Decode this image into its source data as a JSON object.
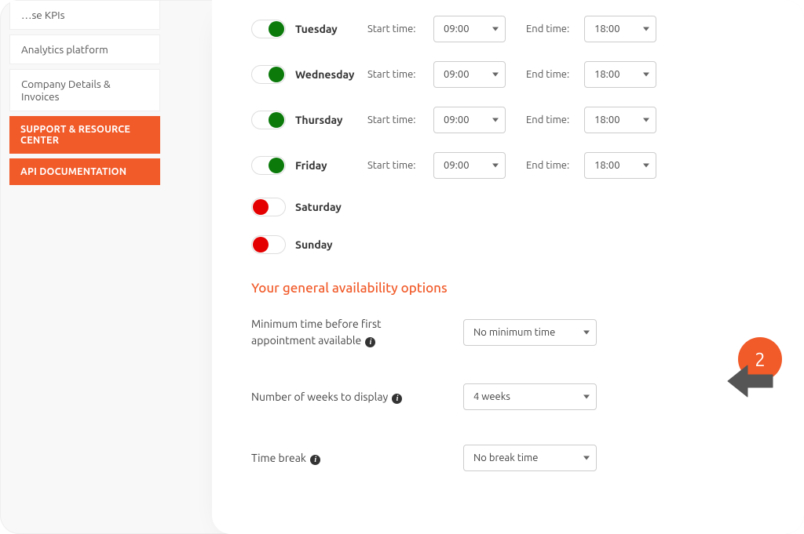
{
  "sidebar": {
    "items": [
      {
        "label": "…se KPIs"
      },
      {
        "label": "Analytics platform"
      },
      {
        "label": "Company Details & Invoices"
      },
      {
        "label": "SUPPORT & RESOURCE CENTER",
        "primary": true
      },
      {
        "label": "API DOCUMENTATION",
        "primary": true
      }
    ]
  },
  "schedule": {
    "start_label": "Start time:",
    "end_label": "End time:",
    "days": [
      {
        "name": "Tuesday",
        "on": true,
        "start": "09:00",
        "end": "18:00"
      },
      {
        "name": "Wednesday",
        "on": true,
        "start": "09:00",
        "end": "18:00"
      },
      {
        "name": "Thursday",
        "on": true,
        "start": "09:00",
        "end": "18:00"
      },
      {
        "name": "Friday",
        "on": true,
        "start": "09:00",
        "end": "18:00"
      },
      {
        "name": "Saturday",
        "on": false
      },
      {
        "name": "Sunday",
        "on": false
      }
    ]
  },
  "options": {
    "section_title": "Your general availability options",
    "min_time_label": "Minimum time before first appointment available",
    "min_time_value": "No minimum time",
    "weeks_label": "Number of weeks to display",
    "weeks_value": "4 weeks",
    "break_label": "Time break",
    "break_value": "No break time"
  },
  "annotation": {
    "step": "2"
  }
}
